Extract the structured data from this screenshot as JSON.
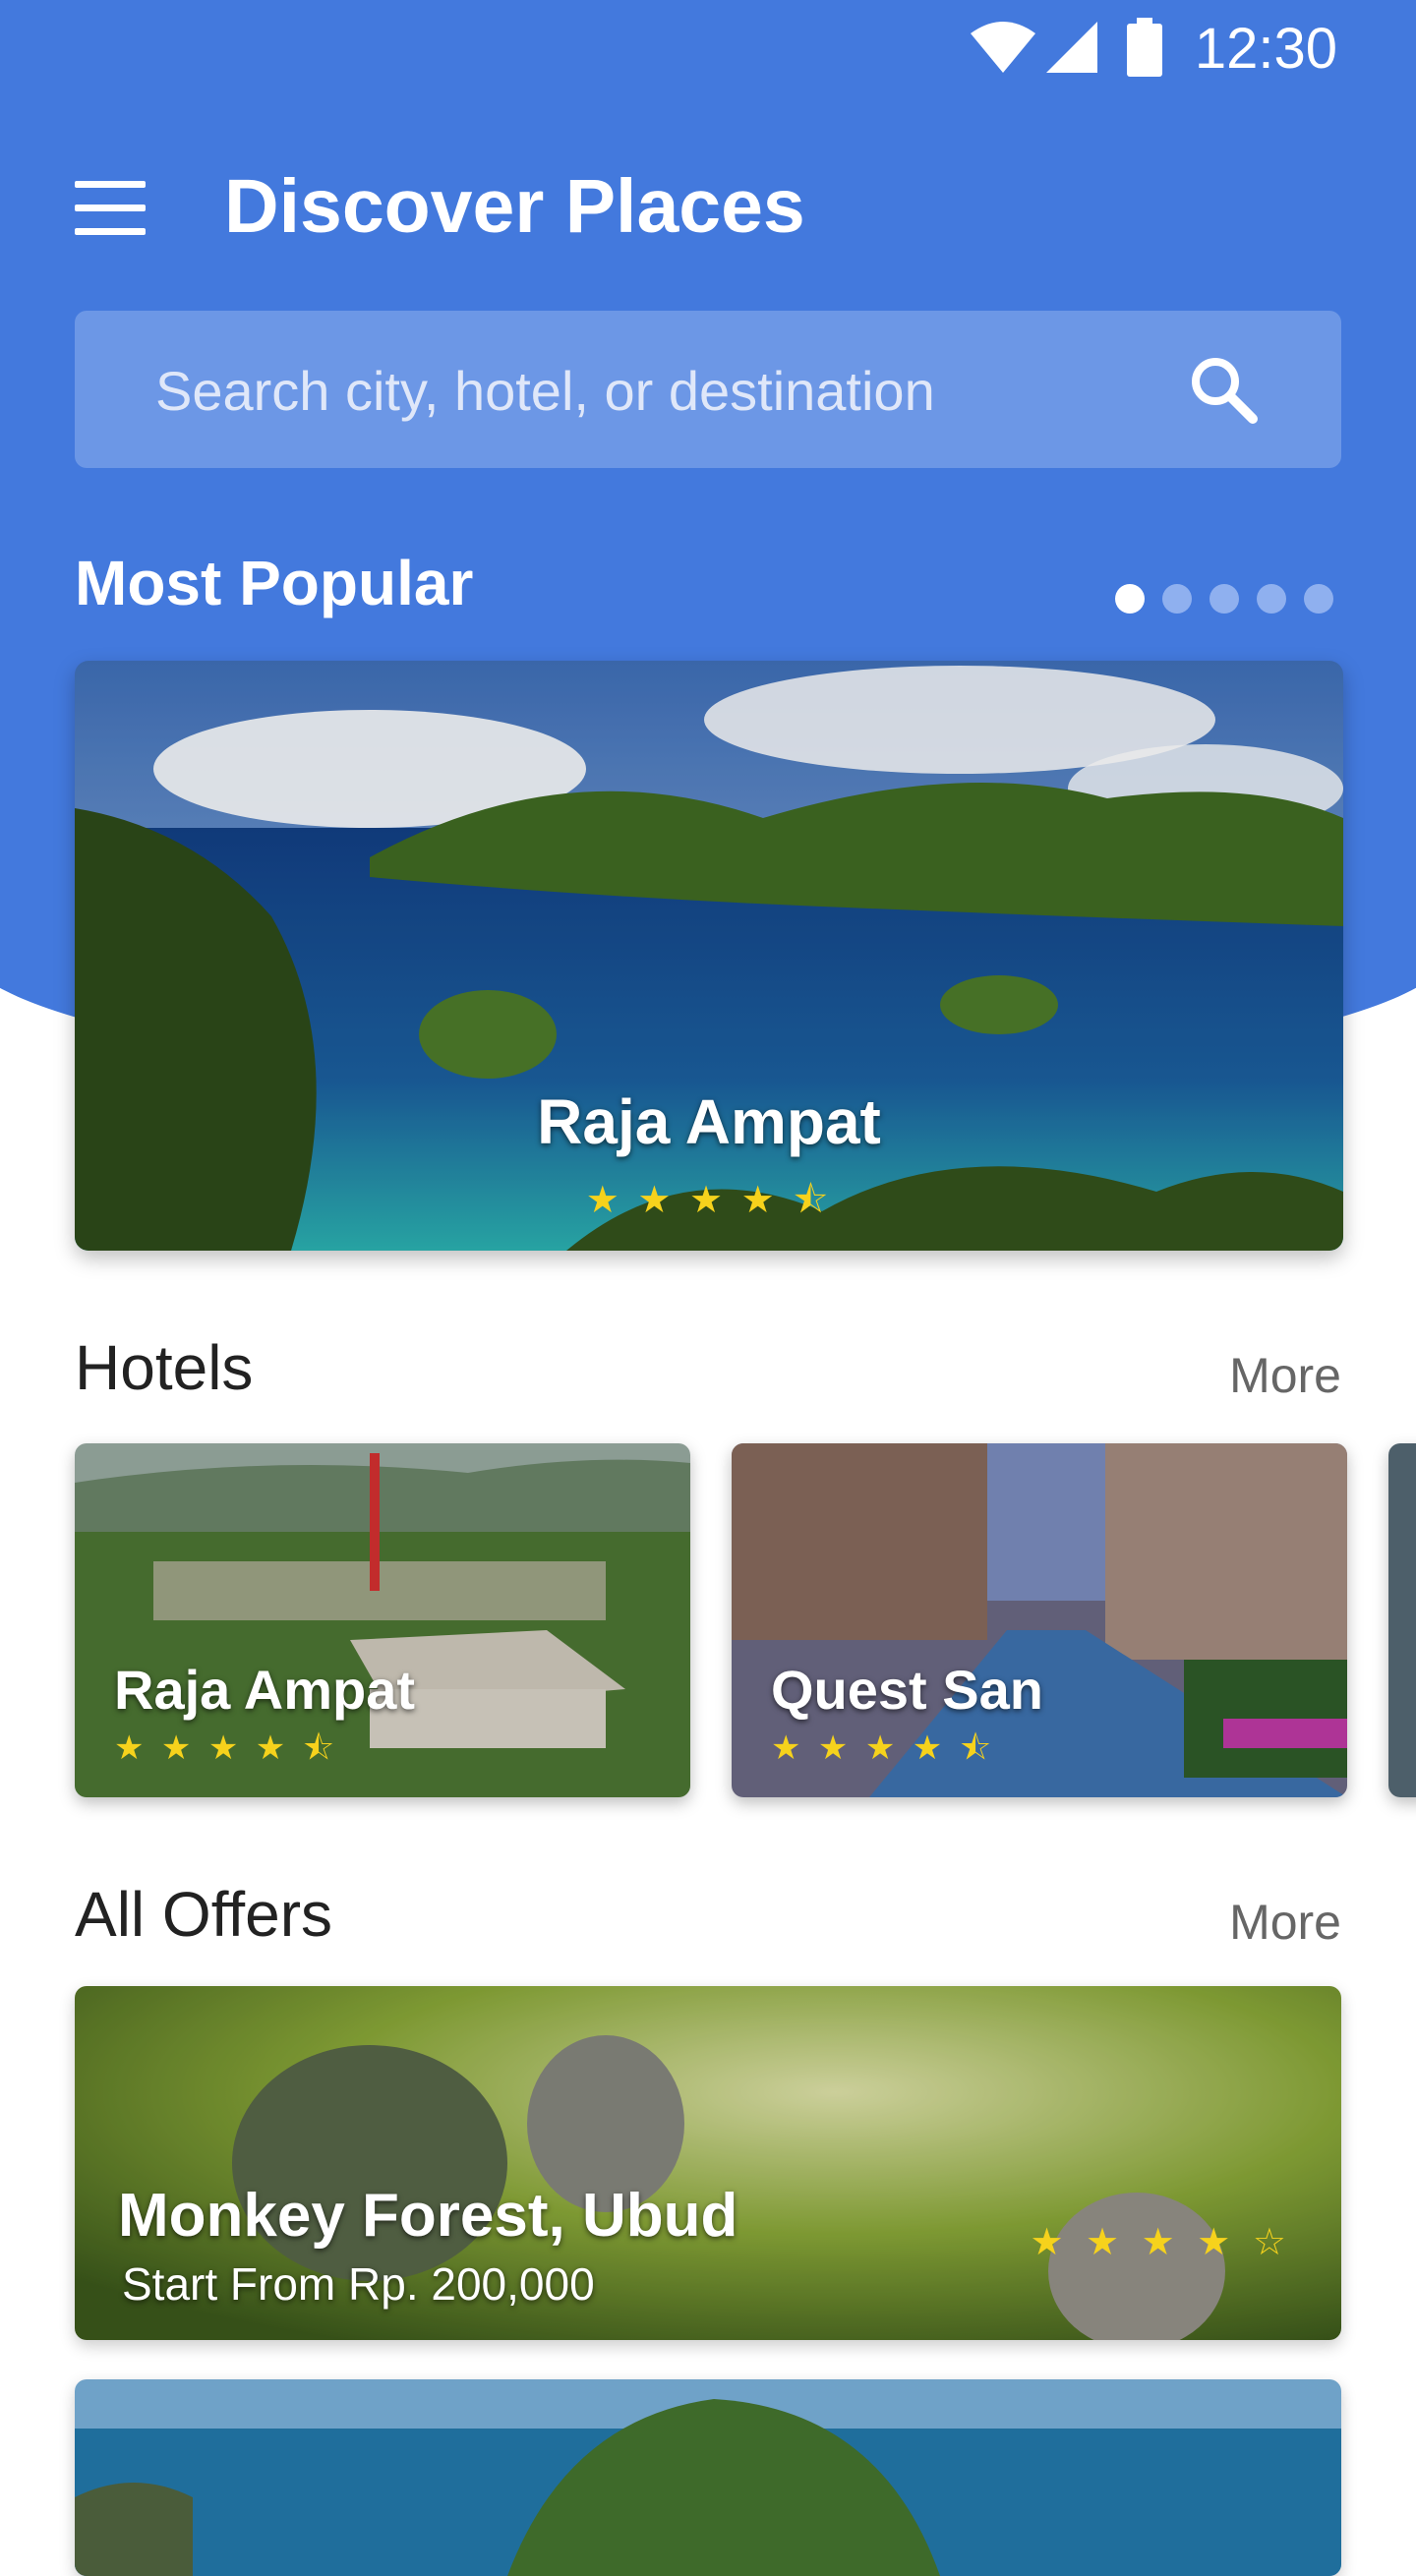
{
  "status_bar": {
    "time": "12:30"
  },
  "header": {
    "title": "Discover Places"
  },
  "search": {
    "placeholder": "Search city, hotel, or destination"
  },
  "most_popular": {
    "title": "Most Popular",
    "carousel_pages": 5,
    "active_page": 1,
    "card": {
      "name": "Raja Ampat",
      "rating": 4.5,
      "stars": "★ ★ ★ ★ ⯪"
    }
  },
  "hotels": {
    "title": "Hotels",
    "more_label": "More",
    "items": [
      {
        "name": "Raja Ampat",
        "rating": 4.5,
        "stars": "★ ★ ★ ★ ⯪"
      },
      {
        "name": "Quest San",
        "rating": 4.5,
        "stars": "★ ★ ★ ★ ⯪"
      }
    ]
  },
  "offers": {
    "title": "All Offers",
    "more_label": "More",
    "items": [
      {
        "name": "Monkey Forest, Ubud",
        "price": "Start From Rp. 200,000",
        "rating": 4,
        "stars": "★ ★ ★ ★ ☆"
      }
    ]
  },
  "colors": {
    "primary": "#4379dd",
    "search_bg": "#6c97e6",
    "star": "#f6d21c"
  }
}
